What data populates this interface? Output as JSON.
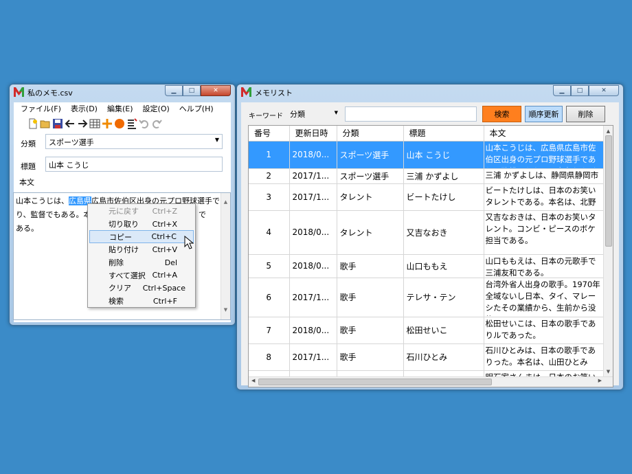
{
  "memo": {
    "title": "私のメモ.csv",
    "menu": [
      "ファイル(F)",
      "表示(D)",
      "編集(E)",
      "設定(O)",
      "ヘルプ(H)"
    ],
    "category_label": "分類",
    "category_value": "スポーツ選手",
    "title_label": "標題",
    "title_value": "山本 こうじ",
    "body_label": "本文",
    "body_line1_pre": "山本こうじは、",
    "body_line1_sel": "広島県",
    "body_line1_post": "広島市佐伯区出身の元プロ野球選手で",
    "body_line2a": "り、監督でもある。本",
    "body_line2b": "」で",
    "body_line3": "ある。"
  },
  "context_menu": [
    {
      "label": "元に戻す",
      "shortcut": "Ctrl+Z",
      "disabled": true
    },
    {
      "label": "切り取り",
      "shortcut": "Ctrl+X"
    },
    {
      "label": "コピー",
      "shortcut": "Ctrl+C",
      "highlighted": true
    },
    {
      "label": "貼り付け",
      "shortcut": "Ctrl+V"
    },
    {
      "label": "削除",
      "shortcut": "Del"
    },
    {
      "label": "すべて選択",
      "shortcut": "Ctrl+A"
    },
    {
      "label": "クリア",
      "shortcut": "Ctrl+Space"
    },
    {
      "label": "検索",
      "shortcut": "Ctrl+F"
    }
  ],
  "list": {
    "title": "メモリスト",
    "keyword_label": "キーワード",
    "filter_value": "分類",
    "search_value": "",
    "search_button": "検索",
    "sort_button": "順序更新",
    "delete_button": "削除",
    "columns": [
      "番号",
      "更新日時",
      "分類",
      "標題",
      "本文"
    ],
    "rows": [
      {
        "no": "1",
        "date": "2018/0...",
        "cat": "スポーツ選手",
        "title": "山本 こうじ",
        "body": "山本こうじは、広島県広島市佐伯区出身の元プロ野球選手であり、監督でもある。本名および旧登録名は"
      },
      {
        "no": "2",
        "date": "2017/1...",
        "cat": "スポーツ選手",
        "title": "三浦 かずよし",
        "body": "三浦 かずよしは、静岡県静岡市"
      },
      {
        "no": "3",
        "date": "2017/1...",
        "cat": "タレント",
        "title": "ビートたけし",
        "body": "ビートたけしは、日本のお笑いタレントである。本名は、北野 武である。東"
      },
      {
        "no": "4",
        "date": "2018/0...",
        "cat": "タレント",
        "title": "又吉なおき",
        "body": "又吉なおきは、日本のお笑いタレント。コンビ・ピースのボケ担当である。"
      },
      {
        "no": "5",
        "date": "2018/0...",
        "cat": "歌手",
        "title": "山口ももえ",
        "body": "山口ももえは、日本の元歌手で三浦友和である。"
      },
      {
        "no": "6",
        "date": "2017/1...",
        "cat": "歌手",
        "title": "テレサ・テン",
        "body": "台湾外省人出身の歌手。1970年全域ないし日本、タイ、マレーシたその業績から、生前から没後"
      },
      {
        "no": "7",
        "date": "2018/0...",
        "cat": "歌手",
        "title": "松田せいこ",
        "body": "松田せいこは、日本の歌手でありルであった。"
      },
      {
        "no": "8",
        "date": "2017/1...",
        "cat": "歌手",
        "title": "石川ひとみ",
        "body": "石川ひとみは、日本の歌手でありった。本名は、山田ひとみ（旧"
      },
      {
        "no": "",
        "date": "",
        "cat": "",
        "title": "",
        "body": "明石家さんまは、日本のお笑い"
      }
    ]
  },
  "colors": {
    "desktop": "#3b8bc8",
    "selection": "#3399ff",
    "search_btn": "#ff7f1e",
    "sort_btn": "#bcdcfb"
  }
}
